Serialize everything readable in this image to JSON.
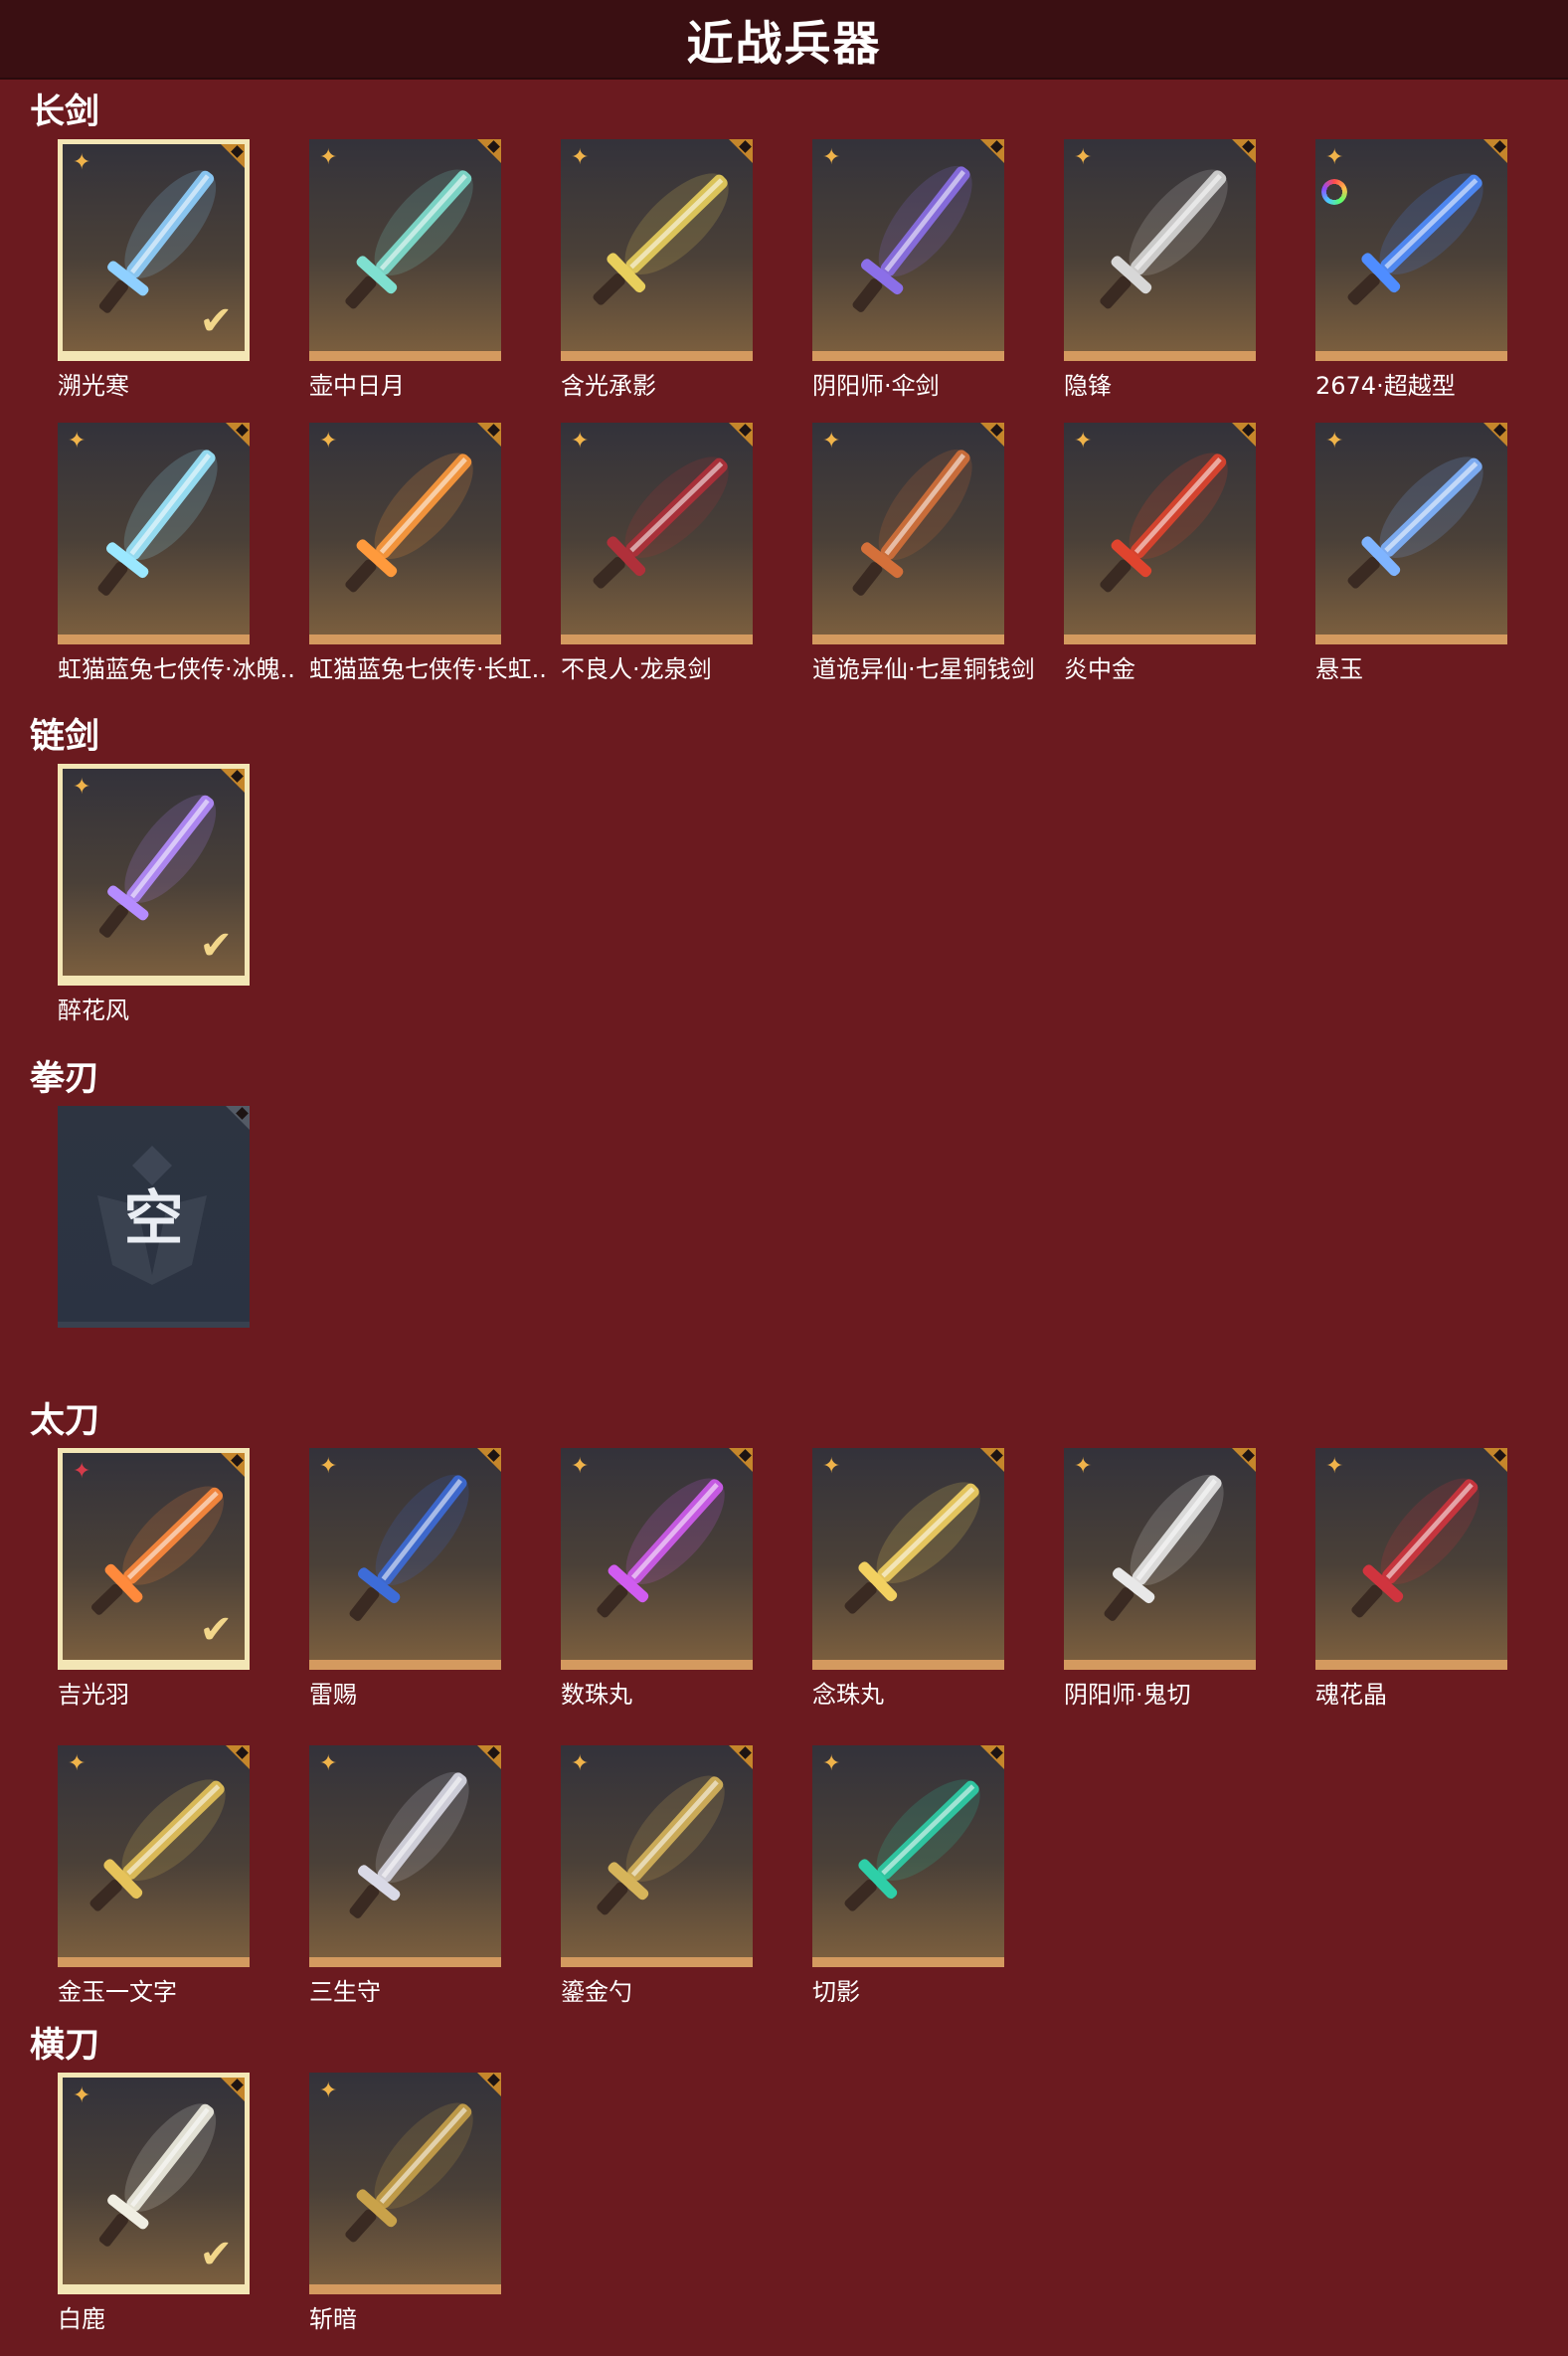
{
  "page_title": "近战兵器",
  "sections": [
    {
      "title": "长剑",
      "items": [
        {
          "name": "溯光寒",
          "selected": true,
          "color": "#8fd0ff"
        },
        {
          "name": "壶中日月",
          "selected": false,
          "color": "#7fe0d0"
        },
        {
          "name": "含光承影",
          "selected": false,
          "color": "#e8cf5c"
        },
        {
          "name": "阴阳师·伞剑",
          "selected": false,
          "color": "#8b6fe8"
        },
        {
          "name": "隐锋",
          "selected": false,
          "color": "#d7d7d7"
        },
        {
          "name": "2674·超越型",
          "selected": false,
          "color": "#4f8dff",
          "ring": true
        },
        {
          "name": "虹猫蓝兔七侠传·冰魄..",
          "selected": false,
          "color": "#9be8ff"
        },
        {
          "name": "虹猫蓝兔七侠传·长虹..",
          "selected": false,
          "color": "#ff9a3c"
        },
        {
          "name": "不良人·龙泉剑",
          "selected": false,
          "color": "#b0303a"
        },
        {
          "name": "道诡异仙·七星铜钱剑",
          "selected": false,
          "color": "#d4703a"
        },
        {
          "name": "炎中金",
          "selected": false,
          "color": "#e0442e"
        },
        {
          "name": "悬玉",
          "selected": false,
          "color": "#7fb4ff"
        }
      ]
    },
    {
      "title": "链剑",
      "items": [
        {
          "name": "醉花风",
          "selected": true,
          "color": "#b58cff"
        }
      ]
    },
    {
      "title": "拳刃",
      "items": [
        {
          "name": "",
          "empty": true,
          "empty_text": "空"
        }
      ]
    },
    {
      "title": "太刀",
      "items": [
        {
          "name": "吉光羽",
          "selected": true,
          "color": "#ff8a3c",
          "star": "red"
        },
        {
          "name": "雷赐",
          "selected": false,
          "color": "#3d6cd8"
        },
        {
          "name": "数珠丸",
          "selected": false,
          "color": "#d05cf0"
        },
        {
          "name": "念珠丸",
          "selected": false,
          "color": "#f2d060"
        },
        {
          "name": "阴阳师·鬼切",
          "selected": false,
          "color": "#e8e8e8"
        },
        {
          "name": "魂花晶",
          "selected": false,
          "color": "#d0343e"
        },
        {
          "name": "金玉一文字",
          "selected": false,
          "color": "#e6c35a"
        },
        {
          "name": "三生守",
          "selected": false,
          "color": "#d9d9e6"
        },
        {
          "name": "鎏金勺",
          "selected": false,
          "color": "#d6b45a"
        },
        {
          "name": "切影",
          "selected": false,
          "color": "#2ecfa8"
        }
      ]
    },
    {
      "title": "横刀",
      "items": [
        {
          "name": "白鹿",
          "selected": true,
          "color": "#f0eee2"
        },
        {
          "name": "斩暗",
          "selected": false,
          "color": "#c9a24a"
        }
      ]
    }
  ]
}
